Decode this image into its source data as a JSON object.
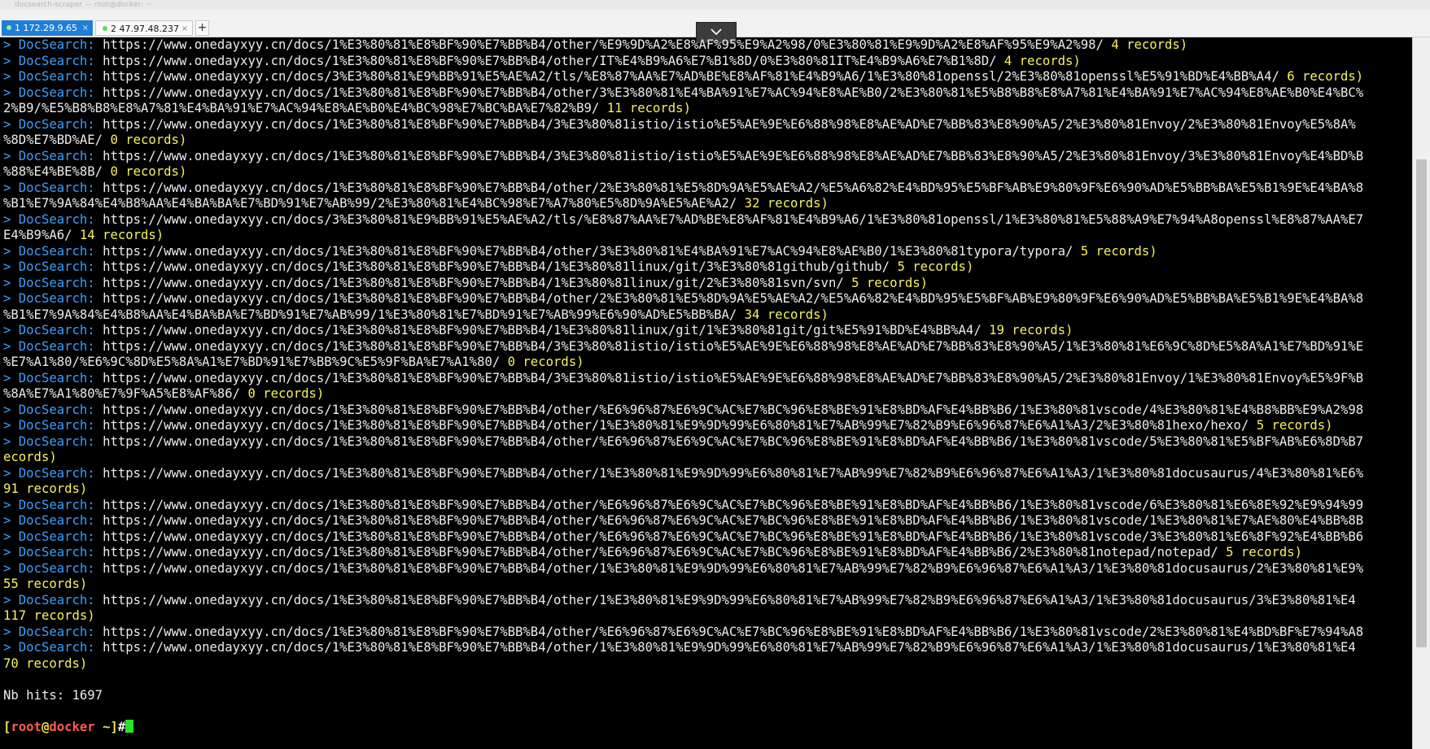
{
  "window": {
    "faint_title": "docsearch-scraper — root@docker: ~"
  },
  "tabs": [
    {
      "label": "1 172.29.9.65",
      "active": true
    },
    {
      "label": "2 47.97.48.237",
      "active": false
    }
  ],
  "terminal": {
    "lines": [
      {
        "kind": "doc",
        "prefix": "> ",
        "label": "DocSearch:",
        "url": "https://www.onedayxyy.cn/docs/1%E3%80%81%E8%BF%90%E7%BB%B4/other/%E9%9D%A2%E8%AF%95%E9%A2%98/0%E3%80%81%E9%9D%A2%E8%AF%95%E9%A2%98/",
        "records": "4 records)"
      },
      {
        "kind": "doc",
        "prefix": "> ",
        "label": "DocSearch:",
        "url": "https://www.onedayxyy.cn/docs/1%E3%80%81%E8%BF%90%E7%BB%B4/other/IT%E4%B9%A6%E7%B1%8D/0%E3%80%81IT%E4%B9%A6%E7%B1%8D/",
        "records": "4 records)"
      },
      {
        "kind": "doc",
        "prefix": "> ",
        "label": "DocSearch:",
        "url": "https://www.onedayxyy.cn/docs/3%E3%80%81%E9%BB%91%E5%AE%A2/tls/%E8%87%AA%E7%AD%BE%E8%AF%81%E4%B9%A6/1%E3%80%81openssl/2%E3%80%81openssl%E5%91%BD%E4%BB%A4/",
        "records": "6 records)"
      },
      {
        "kind": "doc",
        "prefix": "> ",
        "label": "DocSearch:",
        "url": "https://www.onedayxyy.cn/docs/1%E3%80%81%E8%BF%90%E7%BB%B4/other/3%E3%80%81%E4%BA%91%E7%AC%94%E8%AE%B0/2%E3%80%81%E5%B8%B8%E8%A7%81%E4%BA%91%E7%AC%94%E8%AE%B0%E4%BC%",
        "records": ""
      },
      {
        "kind": "cont",
        "text": "2%B9/%E5%B8%B8%E8%A7%81%E4%BA%91%E7%AC%94%E8%AE%B0%E4%BC%98%E7%BC%BA%E7%82%B9/",
        "records": "11 records)"
      },
      {
        "kind": "doc",
        "prefix": "> ",
        "label": "DocSearch:",
        "url": "https://www.onedayxyy.cn/docs/1%E3%80%81%E8%BF%90%E7%BB%B4/3%E3%80%81istio/istio%E5%AE%9E%E6%88%98%E8%AE%AD%E7%BB%83%E8%90%A5/2%E3%80%81Envoy/2%E3%80%81Envoy%E5%8A%",
        "records": ""
      },
      {
        "kind": "cont",
        "text": "%8D%E7%BD%AE/",
        "records": "0 records)"
      },
      {
        "kind": "doc",
        "prefix": "> ",
        "label": "DocSearch:",
        "url": "https://www.onedayxyy.cn/docs/1%E3%80%81%E8%BF%90%E7%BB%B4/3%E3%80%81istio/istio%E5%AE%9E%E6%88%98%E8%AE%AD%E7%BB%83%E8%90%A5/2%E3%80%81Envoy/3%E3%80%81Envoy%E4%BD%B",
        "records": ""
      },
      {
        "kind": "cont",
        "text": "%88%E4%BE%8B/",
        "records": "0 records)"
      },
      {
        "kind": "doc",
        "prefix": "> ",
        "label": "DocSearch:",
        "url": "https://www.onedayxyy.cn/docs/1%E3%80%81%E8%BF%90%E7%BB%B4/other/2%E3%80%81%E5%8D%9A%E5%AE%A2/%E5%A6%82%E4%BD%95%E5%BF%AB%E9%80%9F%E6%90%AD%E5%BB%BA%E5%B1%9E%E4%BA%8",
        "records": ""
      },
      {
        "kind": "cont",
        "text": "%B1%E7%9A%84%E4%B8%AA%E4%BA%BA%E7%BD%91%E7%AB%99/2%E3%80%81%E4%BC%98%E7%A7%80%E5%8D%9A%E5%AE%A2/",
        "records": "32 records)"
      },
      {
        "kind": "doc",
        "prefix": "> ",
        "label": "DocSearch:",
        "url": "https://www.onedayxyy.cn/docs/3%E3%80%81%E9%BB%91%E5%AE%A2/tls/%E8%87%AA%E7%AD%BE%E8%AF%81%E4%B9%A6/1%E3%80%81openssl/1%E3%80%81%E5%88%A9%E7%94%A8openssl%E8%87%AA%E7",
        "records": ""
      },
      {
        "kind": "cont",
        "text": "E4%B9%A6/",
        "records": "14 records)"
      },
      {
        "kind": "doc",
        "prefix": "> ",
        "label": "DocSearch:",
        "url": "https://www.onedayxyy.cn/docs/1%E3%80%81%E8%BF%90%E7%BB%B4/other/3%E3%80%81%E4%BA%91%E7%AC%94%E8%AE%B0/1%E3%80%81typora/typora/",
        "records": "5 records)"
      },
      {
        "kind": "doc",
        "prefix": "> ",
        "label": "DocSearch:",
        "url": "https://www.onedayxyy.cn/docs/1%E3%80%81%E8%BF%90%E7%BB%B4/1%E3%80%81linux/git/3%E3%80%81github/github/",
        "records": "5 records)"
      },
      {
        "kind": "doc",
        "prefix": "> ",
        "label": "DocSearch:",
        "url": "https://www.onedayxyy.cn/docs/1%E3%80%81%E8%BF%90%E7%BB%B4/1%E3%80%81linux/git/2%E3%80%81svn/svn/",
        "records": "5 records)"
      },
      {
        "kind": "doc",
        "prefix": "> ",
        "label": "DocSearch:",
        "url": "https://www.onedayxyy.cn/docs/1%E3%80%81%E8%BF%90%E7%BB%B4/other/2%E3%80%81%E5%8D%9A%E5%AE%A2/%E5%A6%82%E4%BD%95%E5%BF%AB%E9%80%9F%E6%90%AD%E5%BB%BA%E5%B1%9E%E4%BA%8",
        "records": ""
      },
      {
        "kind": "cont",
        "text": "%B1%E7%9A%84%E4%B8%AA%E4%BA%BA%E7%BD%91%E7%AB%99/1%E3%80%81%E7%BD%91%E7%AB%99%E6%90%AD%E5%BB%BA/",
        "records": "34 records)"
      },
      {
        "kind": "doc",
        "prefix": "> ",
        "label": "DocSearch:",
        "url": "https://www.onedayxyy.cn/docs/1%E3%80%81%E8%BF%90%E7%BB%B4/1%E3%80%81linux/git/1%E3%80%81git/git%E5%91%BD%E4%BB%A4/",
        "records": "19 records)"
      },
      {
        "kind": "doc",
        "prefix": "> ",
        "label": "DocSearch:",
        "url": "https://www.onedayxyy.cn/docs/1%E3%80%81%E8%BF%90%E7%BB%B4/3%E3%80%81istio/istio%E5%AE%9E%E6%88%98%E8%AE%AD%E7%BB%83%E8%90%A5/1%E3%80%81%E6%9C%8D%E5%8A%A1%E7%BD%91%E",
        "records": ""
      },
      {
        "kind": "cont",
        "text": "%E7%A1%80/%E6%9C%8D%E5%8A%A1%E7%BD%91%E7%BB%9C%E5%9F%BA%E7%A1%80/",
        "records": "0 records)"
      },
      {
        "kind": "doc",
        "prefix": "> ",
        "label": "DocSearch:",
        "url": "https://www.onedayxyy.cn/docs/1%E3%80%81%E8%BF%90%E7%BB%B4/3%E3%80%81istio/istio%E5%AE%9E%E6%88%98%E8%AE%AD%E7%BB%83%E8%90%A5/2%E3%80%81Envoy/1%E3%80%81Envoy%E5%9F%B",
        "records": ""
      },
      {
        "kind": "cont",
        "text": "%8A%E7%A1%80%E7%9F%A5%E8%AF%86/",
        "records": "0 records)"
      },
      {
        "kind": "doc",
        "prefix": "> ",
        "label": "DocSearch:",
        "url": "https://www.onedayxyy.cn/docs/1%E3%80%81%E8%BF%90%E7%BB%B4/other/%E6%96%87%E6%9C%AC%E7%BC%96%E8%BE%91%E8%BD%AF%E4%BB%B6/1%E3%80%81vscode/4%E3%80%81%E4%B8%BB%E9%A2%98",
        "records": ""
      },
      {
        "kind": "doc",
        "prefix": "> ",
        "label": "DocSearch:",
        "url": "https://www.onedayxyy.cn/docs/1%E3%80%81%E8%BF%90%E7%BB%B4/other/1%E3%80%81%E9%9D%99%E6%80%81%E7%AB%99%E7%82%B9%E6%96%87%E6%A1%A3/2%E3%80%81hexo/hexo/",
        "records": "5 records)"
      },
      {
        "kind": "doc",
        "prefix": "> ",
        "label": "DocSearch:",
        "url": "https://www.onedayxyy.cn/docs/1%E3%80%81%E8%BF%90%E7%BB%B4/other/%E6%96%87%E6%9C%AC%E7%BC%96%E8%BE%91%E8%BD%AF%E4%BB%B6/1%E3%80%81vscode/5%E3%80%81%E5%BF%AB%E6%8D%B7",
        "records": ""
      },
      {
        "kind": "cont",
        "text": "ecords)",
        "records": ""
      },
      {
        "kind": "doc",
        "prefix": "> ",
        "label": "DocSearch:",
        "url": "https://www.onedayxyy.cn/docs/1%E3%80%81%E8%BF%90%E7%BB%B4/other/1%E3%80%81%E9%9D%99%E6%80%81%E7%AB%99%E7%82%B9%E6%96%87%E6%A1%A3/1%E3%80%81docusaurus/4%E3%80%81%E6%",
        "records": ""
      },
      {
        "kind": "cont",
        "text": "91 records)",
        "records": ""
      },
      {
        "kind": "doc",
        "prefix": "> ",
        "label": "DocSearch:",
        "url": "https://www.onedayxyy.cn/docs/1%E3%80%81%E8%BF%90%E7%BB%B4/other/%E6%96%87%E6%9C%AC%E7%BC%96%E8%BE%91%E8%BD%AF%E4%BB%B6/1%E3%80%81vscode/6%E3%80%81%E6%8E%92%E9%94%99",
        "records": ""
      },
      {
        "kind": "doc",
        "prefix": "> ",
        "label": "DocSearch:",
        "url": "https://www.onedayxyy.cn/docs/1%E3%80%81%E8%BF%90%E7%BB%B4/other/%E6%96%87%E6%9C%AC%E7%BC%96%E8%BE%91%E8%BD%AF%E4%BB%B6/1%E3%80%81vscode/1%E3%80%81%E7%AE%80%E4%BB%8B",
        "records": ""
      },
      {
        "kind": "doc",
        "prefix": "> ",
        "label": "DocSearch:",
        "url": "https://www.onedayxyy.cn/docs/1%E3%80%81%E8%BF%90%E7%BB%B4/other/%E6%96%87%E6%9C%AC%E7%BC%96%E8%BE%91%E8%BD%AF%E4%BB%B6/1%E3%80%81vscode/3%E3%80%81%E6%8F%92%E4%BB%B6",
        "records": ""
      },
      {
        "kind": "doc",
        "prefix": "> ",
        "label": "DocSearch:",
        "url": "https://www.onedayxyy.cn/docs/1%E3%80%81%E8%BF%90%E7%BB%B4/other/%E6%96%87%E6%9C%AC%E7%BC%96%E8%BE%91%E8%BD%AF%E4%BB%B6/2%E3%80%81notepad/notepad/",
        "records": "5 records)"
      },
      {
        "kind": "doc",
        "prefix": "> ",
        "label": "DocSearch:",
        "url": "https://www.onedayxyy.cn/docs/1%E3%80%81%E8%BF%90%E7%BB%B4/other/1%E3%80%81%E9%9D%99%E6%80%81%E7%AB%99%E7%82%B9%E6%96%87%E6%A1%A3/1%E3%80%81docusaurus/2%E3%80%81%E9%",
        "records": ""
      },
      {
        "kind": "cont",
        "text": "55 records)",
        "records": ""
      },
      {
        "kind": "doc",
        "prefix": "> ",
        "label": "DocSearch:",
        "url": "https://www.onedayxyy.cn/docs/1%E3%80%81%E8%BF%90%E7%BB%B4/other/1%E3%80%81%E9%9D%99%E6%80%81%E7%AB%99%E7%82%B9%E6%96%87%E6%A1%A3/1%E3%80%81docusaurus/3%E3%80%81%E4",
        "records": ""
      },
      {
        "kind": "cont",
        "text": "117 records)",
        "records": ""
      },
      {
        "kind": "doc",
        "prefix": "> ",
        "label": "DocSearch:",
        "url": "https://www.onedayxyy.cn/docs/1%E3%80%81%E8%BF%90%E7%BB%B4/other/%E6%96%87%E6%9C%AC%E7%BC%96%E8%BE%91%E8%BD%AF%E4%BB%B6/1%E3%80%81vscode/2%E3%80%81%E4%BD%BF%E7%94%A8",
        "records": ""
      },
      {
        "kind": "doc",
        "prefix": "> ",
        "label": "DocSearch:",
        "url": "https://www.onedayxyy.cn/docs/1%E3%80%81%E8%BF%90%E7%BB%B4/other/1%E3%80%81%E9%9D%99%E6%80%81%E7%AB%99%E7%82%B9%E6%96%87%E6%A1%A3/1%E3%80%81docusaurus/1%E3%80%81%E4",
        "records": ""
      },
      {
        "kind": "cont",
        "text": "70 records)",
        "records": ""
      },
      {
        "kind": "blank"
      },
      {
        "kind": "plain",
        "text": "Nb hits: 1697"
      },
      {
        "kind": "blank"
      }
    ],
    "prompt": {
      "open": "[",
      "user": "root",
      "at": "@",
      "host": "docker",
      "path": " ~",
      "close": "]",
      "symbol": "#"
    }
  },
  "colors": {
    "background": "#000000",
    "label": "#3aa0ff",
    "records": "#f7f25a",
    "text": "#ececec",
    "cursor": "#29e029",
    "tab_active": "#1e7fd8"
  },
  "icons": {
    "collapse": "chevron-down-icon",
    "tab_close": "close-icon",
    "new_tab": "plus-icon",
    "status": "connected-dot-icon"
  }
}
